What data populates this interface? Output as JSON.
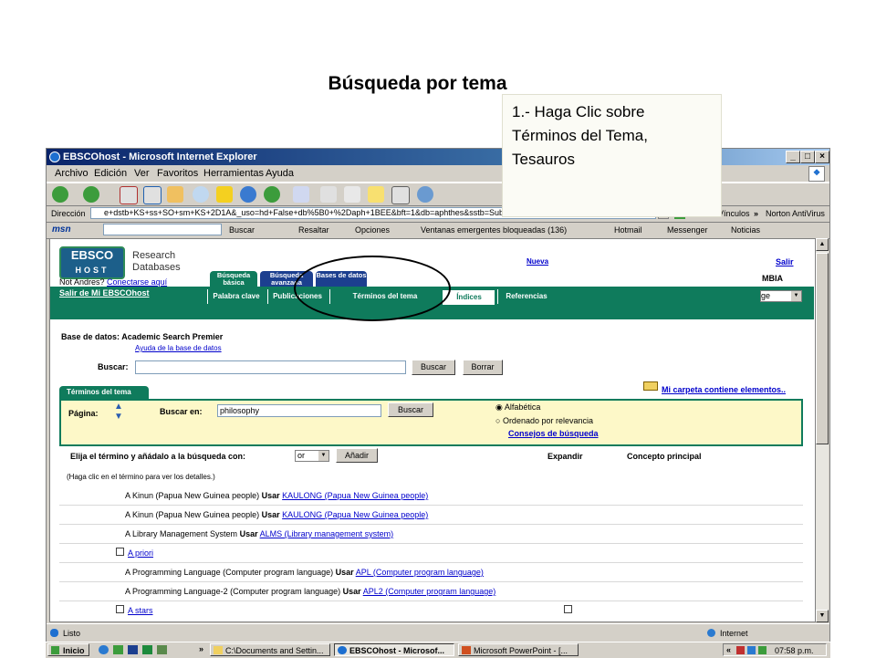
{
  "slide": {
    "title": "Búsqueda por tema"
  },
  "callout": {
    "text": "1.- Haga Clic sobre Términos del Tema, Tesauros"
  },
  "window": {
    "title": "EBSCOhost - Microsoft Internet Explorer",
    "menu": [
      "Archivo",
      "Edición",
      "Ver",
      "Favoritos",
      "Herramientas",
      "Ayuda"
    ],
    "address_label": "Dirección",
    "address_value": "e+dstb+KS+ss+SO+sm+KS+2D1A&_uso=hd+False+db%5B0+%2Daph+1BEE&bft=1&db=aphthes&sstb=Subject+Terms+%28ASP%29",
    "go_label": "Ir",
    "links_label": "Vínculos",
    "norton_label": "Norton AntiVirus",
    "msn_label": "msn",
    "msn_buttons": [
      "Buscar",
      "Resaltar",
      "Opciones",
      "Ventanas emergentes bloqueadas (136)",
      "Hotmail",
      "Messenger",
      "Noticias"
    ],
    "status_left": "Listo",
    "status_right": "Internet"
  },
  "page": {
    "logo_line1": "EBSCO",
    "logo_line2": "HOST",
    "research_line1": "Research",
    "research_line2": "Databases",
    "not_andres": "Not Andres?",
    "conectarse": "Conectarse aquí",
    "salir": "Salir de Mi EBSCOhost",
    "top_tabs": [
      "Búsqueda básica",
      "Búsqueda avanzada",
      "Bases de datos"
    ],
    "green_tabs": [
      "Palabra clave",
      "Publicaciones",
      "Términos del tema",
      "Índices",
      "Referencias"
    ],
    "right_partial_link": "Nueva",
    "right_salir": "Salir",
    "right_mbia": "MBIA",
    "right_select": "ge",
    "db_label": "Base de datos:",
    "db_name": "Academic Search Premier",
    "db_help": "Ayuda de la base de datos",
    "buscar_label": "Buscar:",
    "buscar_button": "Buscar",
    "borrar_button": "Borrar",
    "panel_tab": "Términos del tema",
    "folder_link": "Mi carpeta contiene elementos..",
    "pagina_label": "Página:",
    "buscar_en_label": "Buscar en:",
    "buscar_en_value": "philosophy",
    "buscar_en_button": "Buscar",
    "radio_alfabetica": "Alfabética",
    "radio_relevancia": "Ordenado por relevancia",
    "consejos": "Consejos de búsqueda",
    "elija_label": "Elija el término y añádalo a la búsqueda con:",
    "or_select": "or",
    "anadir_button": "Añadir",
    "col_expandir": "Expandir",
    "col_concepto": "Concepto principal",
    "hint": "(Haga clic en el término para ver los detalles.)",
    "terms": [
      {
        "checkbox": false,
        "prefix": "A Kinun (Papua New Guinea people)",
        "usar": "Usar",
        "link": "KAULONG (Papua New Guinea people)",
        "right_checkbox": false
      },
      {
        "checkbox": false,
        "prefix": "A Kinun (Papua New Guinea people)",
        "usar": "Usar",
        "link": "KAULONG (Papua New Guinea people)",
        "right_checkbox": false
      },
      {
        "checkbox": false,
        "prefix": "A Library Management System",
        "usar": "Usar",
        "link": "ALMS (Library management system)",
        "right_checkbox": false
      },
      {
        "checkbox": true,
        "prefix": "",
        "usar": "",
        "link": "A priori",
        "right_checkbox": false
      },
      {
        "checkbox": false,
        "prefix": "A Programming Language (Computer program language)",
        "usar": "Usar",
        "link": "APL (Computer program language)",
        "right_checkbox": false
      },
      {
        "checkbox": false,
        "prefix": "A Programming Language-2 (Computer program language)",
        "usar": "Usar",
        "link": "APL2 (Computer program language)",
        "right_checkbox": false
      },
      {
        "checkbox": true,
        "prefix": "",
        "usar": "",
        "link": "A stars",
        "right_checkbox": true
      }
    ]
  },
  "taskbar": {
    "start": "Inicio",
    "tasks": [
      "C:\\Documents and Settin...",
      "EBSCOhost - Microsof...",
      "Microsoft PowerPoint - [..."
    ],
    "clock": "07:58 p.m."
  },
  "colors": {
    "ebsco_green": "#0f7b5c",
    "ebsco_blue": "#1c5f8a",
    "ie_title": "#0a246a"
  }
}
